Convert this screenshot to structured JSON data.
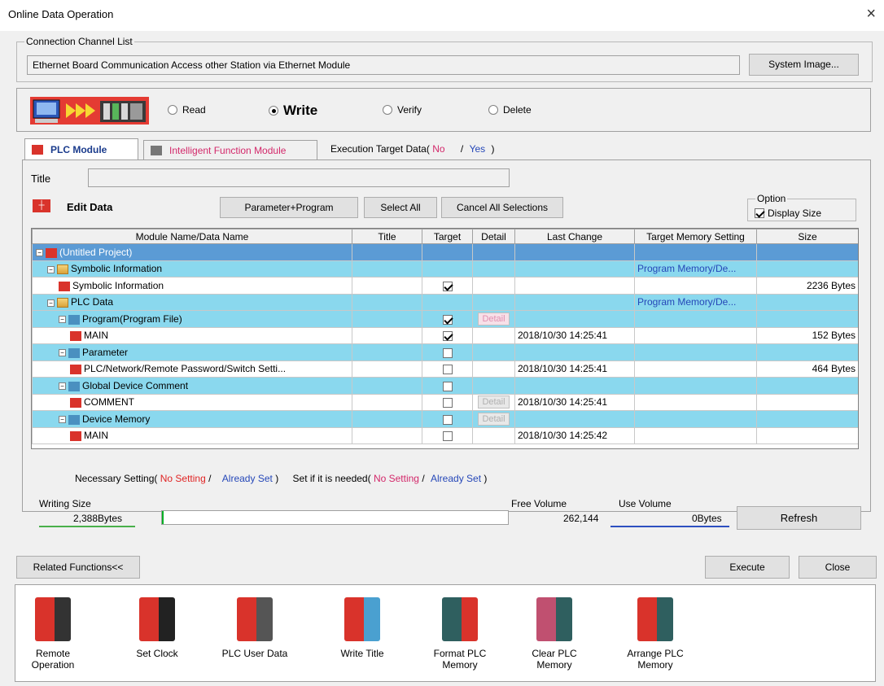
{
  "window": {
    "title": "Online Data Operation",
    "close_glyph": "×"
  },
  "connection": {
    "legend": "Connection Channel List",
    "text": "Ethernet Board Communication  Access other Station via Ethernet Module",
    "system_image_button": "System Image..."
  },
  "mode": {
    "read": "Read",
    "write": "Write",
    "verify": "Verify",
    "delete": "Delete",
    "selected": "Write"
  },
  "tabs": {
    "plc_module": "PLC Module",
    "intelligent": "Intelligent Function Module"
  },
  "execution_target": {
    "label": "Execution Target Data(",
    "no": "No",
    "slash": "/",
    "yes": "Yes",
    "close": ")"
  },
  "title_label": "Title",
  "edit_data_label": "Edit Data",
  "buttons": {
    "param_program": "Parameter+Program",
    "select_all": "Select All",
    "cancel_all": "Cancel All Selections",
    "refresh": "Refresh",
    "related": "Related Functions<<",
    "execute": "Execute",
    "close": "Close"
  },
  "option": {
    "legend": "Option",
    "display_size": "Display Size",
    "checked": true
  },
  "table": {
    "columns": [
      "Module Name/Data Name",
      "Title",
      "Target",
      "Detail",
      "Last Change",
      "Target Memory Setting",
      "Size"
    ],
    "rows": [
      {
        "name": "(Untitled Project)",
        "level": 0,
        "style": "sel",
        "target": null,
        "detail": null,
        "last_change": "",
        "memory": "",
        "size": ""
      },
      {
        "name": "Symbolic Information",
        "level": 1,
        "style": "hl",
        "target": null,
        "detail": null,
        "last_change": "",
        "memory": "Program Memory/De...",
        "size": ""
      },
      {
        "name": "Symbolic Information",
        "level": 2,
        "style": "",
        "target": true,
        "detail": null,
        "last_change": "",
        "memory": "",
        "size": "2236 Bytes"
      },
      {
        "name": "PLC Data",
        "level": 1,
        "style": "hl",
        "target": null,
        "detail": null,
        "last_change": "",
        "memory": "Program Memory/De...",
        "size": ""
      },
      {
        "name": "Program(Program File)",
        "level": 2,
        "style": "hl",
        "target": true,
        "detail": "Detail",
        "last_change": "",
        "memory": "",
        "size": ""
      },
      {
        "name": "MAIN",
        "level": 3,
        "style": "",
        "target": true,
        "detail": null,
        "last_change": "2018/10/30 14:25:41",
        "memory": "",
        "size": "152 Bytes"
      },
      {
        "name": "Parameter",
        "level": 2,
        "style": "hl",
        "target": false,
        "detail": null,
        "last_change": "",
        "memory": "",
        "size": ""
      },
      {
        "name": "PLC/Network/Remote Password/Switch Setti...",
        "level": 3,
        "style": "",
        "target": false,
        "detail": null,
        "last_change": "2018/10/30 14:25:41",
        "memory": "",
        "size": "464 Bytes"
      },
      {
        "name": "Global Device Comment",
        "level": 2,
        "style": "hl",
        "target": false,
        "detail": null,
        "last_change": "",
        "memory": "",
        "size": ""
      },
      {
        "name": "COMMENT",
        "level": 3,
        "style": "",
        "target": false,
        "detail": "Detail",
        "last_change": "2018/10/30 14:25:41",
        "memory": "",
        "size": ""
      },
      {
        "name": "Device Memory",
        "level": 2,
        "style": "hl",
        "target": false,
        "detail": "Detail",
        "last_change": "",
        "memory": "",
        "size": ""
      },
      {
        "name": "MAIN",
        "level": 3,
        "style": "",
        "target": false,
        "detail": null,
        "last_change": "2018/10/30 14:25:42",
        "memory": "",
        "size": ""
      }
    ]
  },
  "legend_line": {
    "necessary": "Necessary Setting(",
    "no_setting": "No Setting",
    "slash": "/",
    "already_set": "Already Set",
    "close": ")",
    "if_needed": "Set if it is needed("
  },
  "writing": {
    "label": "Writing Size",
    "value": "2,388Bytes",
    "progress": 0.005
  },
  "free": {
    "label": "Free Volume",
    "value": "262,144"
  },
  "use": {
    "label": "Use Volume",
    "value": "0Bytes"
  },
  "functions": [
    {
      "label": "Remote Operation",
      "icon": "remote-operation-icon"
    },
    {
      "label": "Set Clock",
      "icon": "set-clock-icon"
    },
    {
      "label": "PLC User Data",
      "icon": "plc-user-data-icon"
    },
    {
      "label": "Write Title",
      "icon": "write-title-icon"
    },
    {
      "label": "Format PLC Memory",
      "icon": "format-plc-memory-icon"
    },
    {
      "label": "Clear PLC Memory",
      "icon": "clear-plc-memory-icon"
    },
    {
      "label": "Arrange PLC Memory",
      "icon": "arrange-plc-memory-icon"
    }
  ]
}
